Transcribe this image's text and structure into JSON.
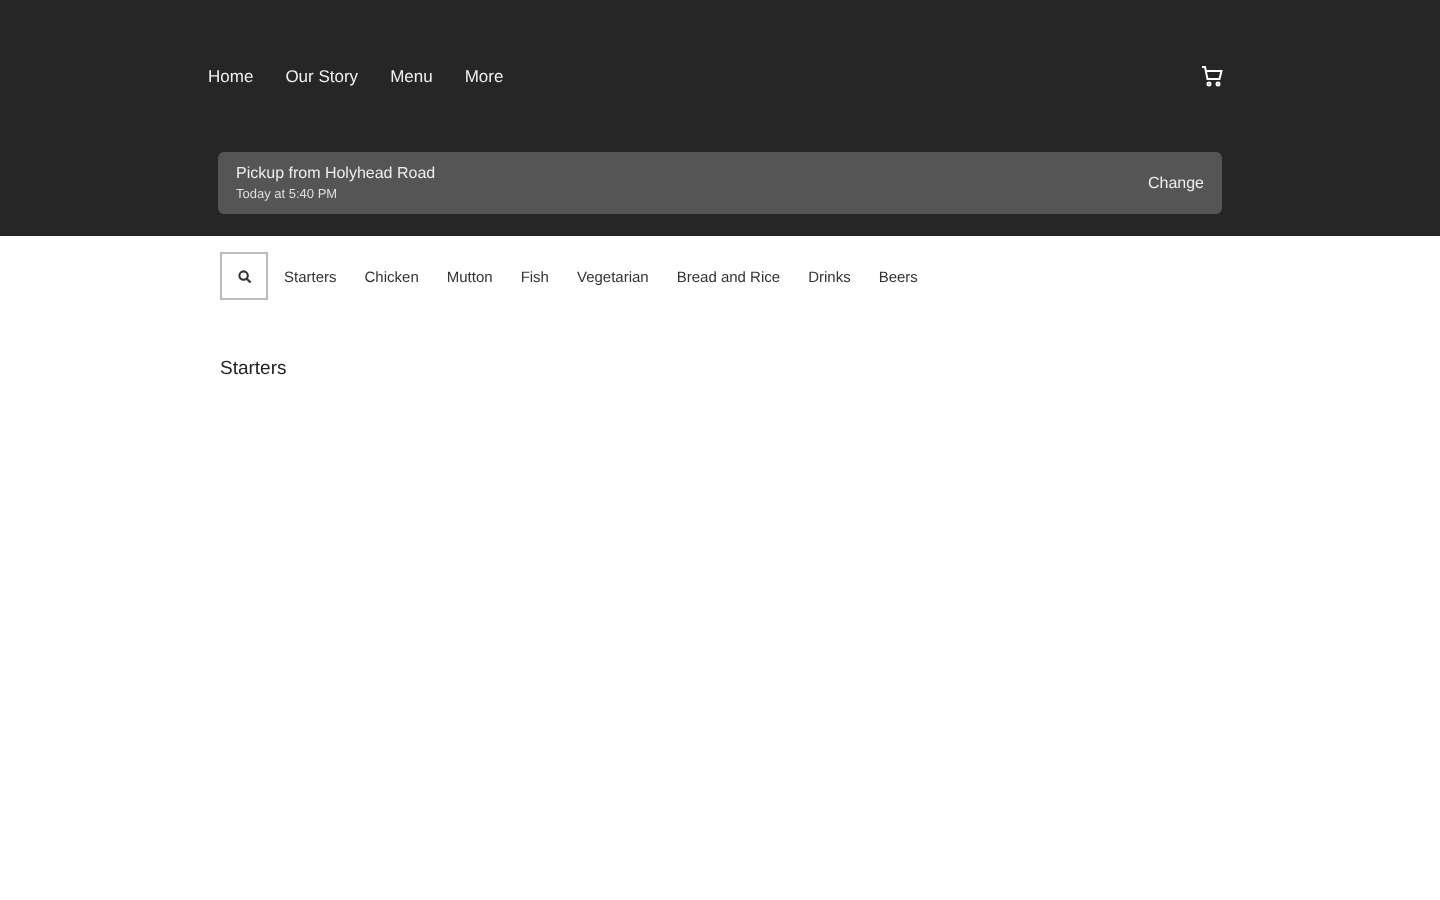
{
  "nav": [
    "Home",
    "Our Story",
    "Menu",
    "More"
  ],
  "pickup": {
    "title": "Pickup from Holyhead Road",
    "time": "Today at 5:40 PM",
    "action": "Change"
  },
  "categories": [
    "Starters",
    "Chicken",
    "Mutton",
    "Fish",
    "Vegetarian",
    "Bread and Rice",
    "Drinks",
    "Beers"
  ],
  "section_title": "Starters"
}
